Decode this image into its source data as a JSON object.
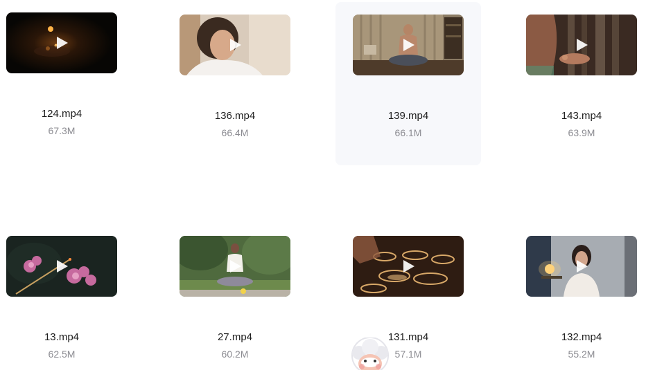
{
  "files": [
    {
      "name": "124.mp4",
      "size": "67.3M",
      "scene": "candles-dark"
    },
    {
      "name": "136.mp4",
      "size": "66.4M",
      "scene": "woman-portrait"
    },
    {
      "name": "139.mp4",
      "size": "66.1M",
      "scene": "man-meditating-room"
    },
    {
      "name": "143.mp4",
      "size": "63.9M",
      "scene": "mudra-hands"
    },
    {
      "name": "13.mp4",
      "size": "62.5M",
      "scene": "incense-flowers"
    },
    {
      "name": "27.mp4",
      "size": "60.2M",
      "scene": "woman-meditating-garden"
    },
    {
      "name": "131.mp4",
      "size": "57.1M",
      "scene": "singing-bowls"
    },
    {
      "name": "132.mp4",
      "size": "55.2M",
      "scene": "woman-lamp-room"
    }
  ],
  "icons": {
    "play": "play-icon",
    "assistant": "assistant-avatar-icon"
  },
  "colors": {
    "hover_bg": "#f7f8fb",
    "name_text": "#1e1e1e",
    "size_text": "#8c8c92"
  }
}
